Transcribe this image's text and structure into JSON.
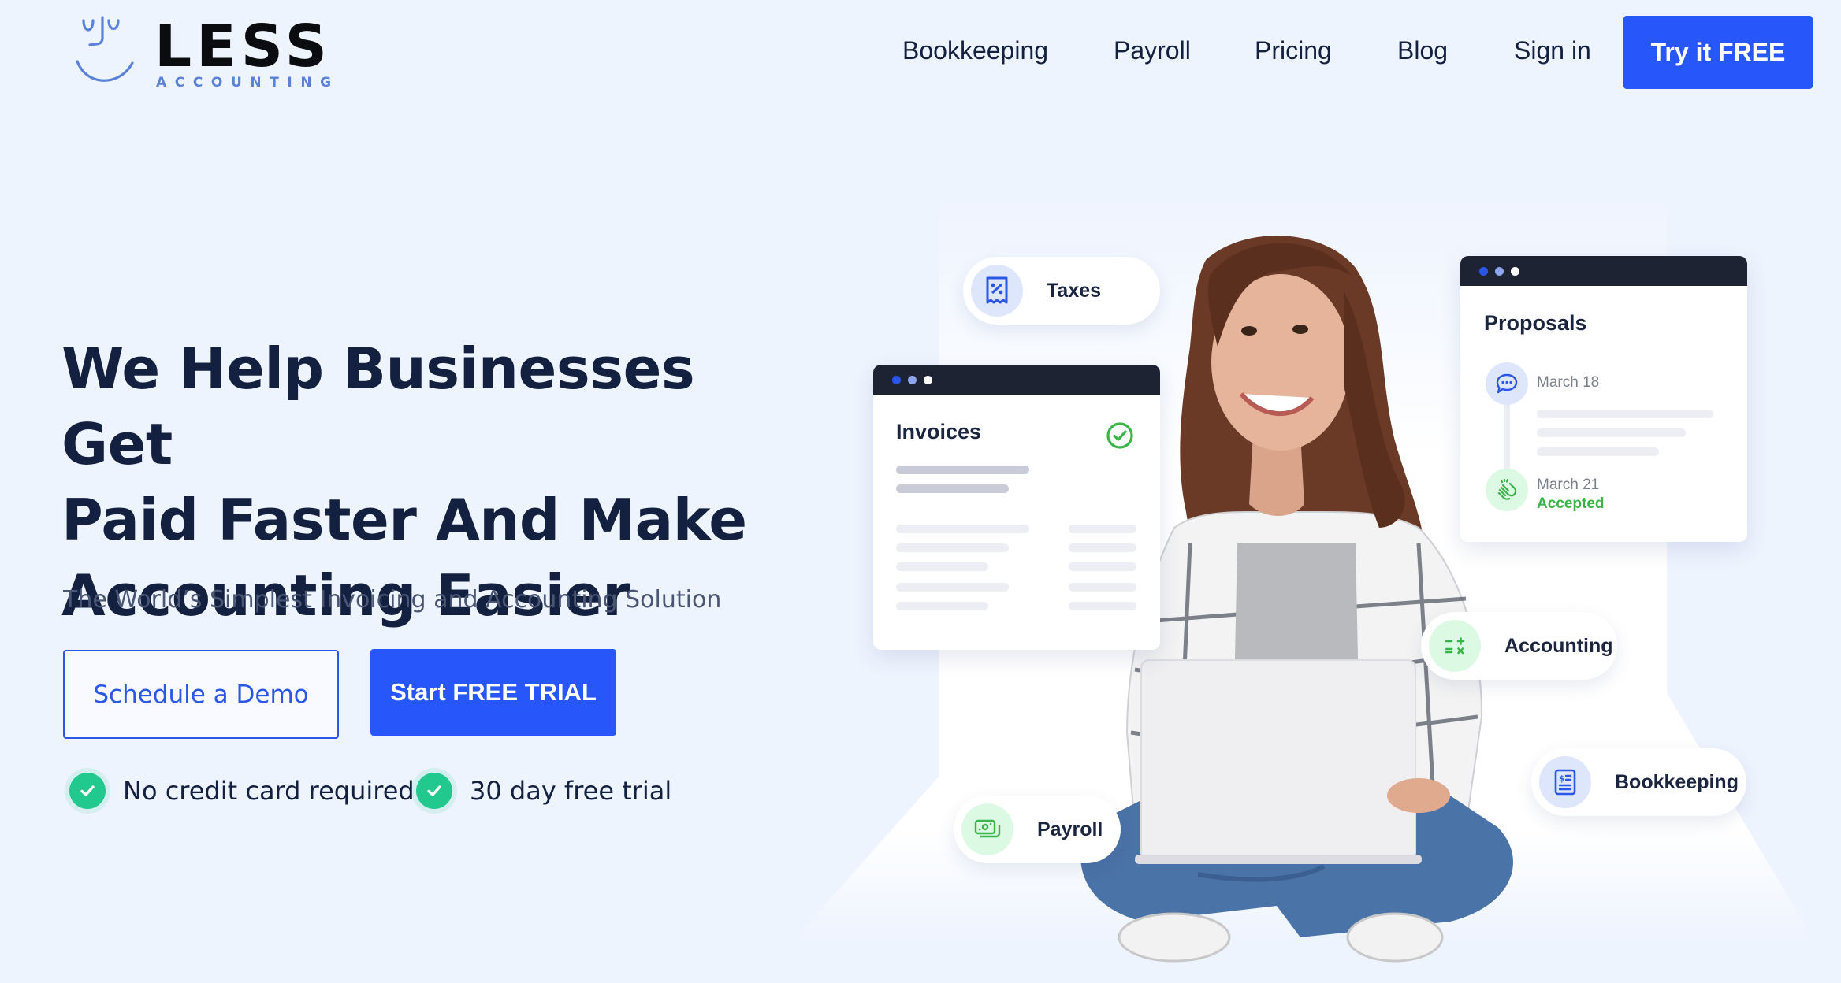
{
  "brand": {
    "name": "LESS",
    "tagline": "ACCOUNTING",
    "logo_icon": "smiley-face-icon"
  },
  "nav": {
    "links": [
      {
        "label": "Bookkeeping"
      },
      {
        "label": "Payroll"
      },
      {
        "label": "Pricing"
      },
      {
        "label": "Blog"
      },
      {
        "label": "Sign in"
      }
    ],
    "cta_label": "Try it FREE"
  },
  "hero": {
    "headline_lines": [
      "We Help Businesses Get",
      "Paid Faster And Make",
      "Accounting Easier"
    ],
    "subtitle": "The World’s Simplest Invoicing and Accounting Solution",
    "secondary_button": "Schedule a Demo",
    "primary_button": "Start FREE TRIAL",
    "perks": [
      {
        "icon": "check-circle-icon",
        "label": "No credit card required"
      },
      {
        "icon": "check-circle-icon",
        "label": "30 day free trial"
      }
    ]
  },
  "illustration": {
    "pills": {
      "taxes": {
        "label": "Taxes",
        "icon": "tax-receipt-icon"
      },
      "accounting": {
        "label": "Accounting",
        "icon": "calculator-symbols-icon"
      },
      "bookkeeping": {
        "label": "Bookkeeping",
        "icon": "ledger-document-icon"
      },
      "payroll": {
        "label": "Payroll",
        "icon": "banknotes-icon"
      }
    },
    "invoices_card": {
      "title": "Invoices",
      "status_icon": "check-circle-outline-icon"
    },
    "proposals_card": {
      "title": "Proposals",
      "events": [
        {
          "date": "March 18",
          "icon": "chat-bubble-icon",
          "status": ""
        },
        {
          "date": "March 21",
          "icon": "clapping-hands-icon",
          "status": "Accepted"
        }
      ]
    }
  },
  "colors": {
    "accent": "#2757fb",
    "text_dark": "#14203f",
    "success": "#22c98e",
    "accepted": "#39b54a",
    "background": "#eef4fe"
  }
}
